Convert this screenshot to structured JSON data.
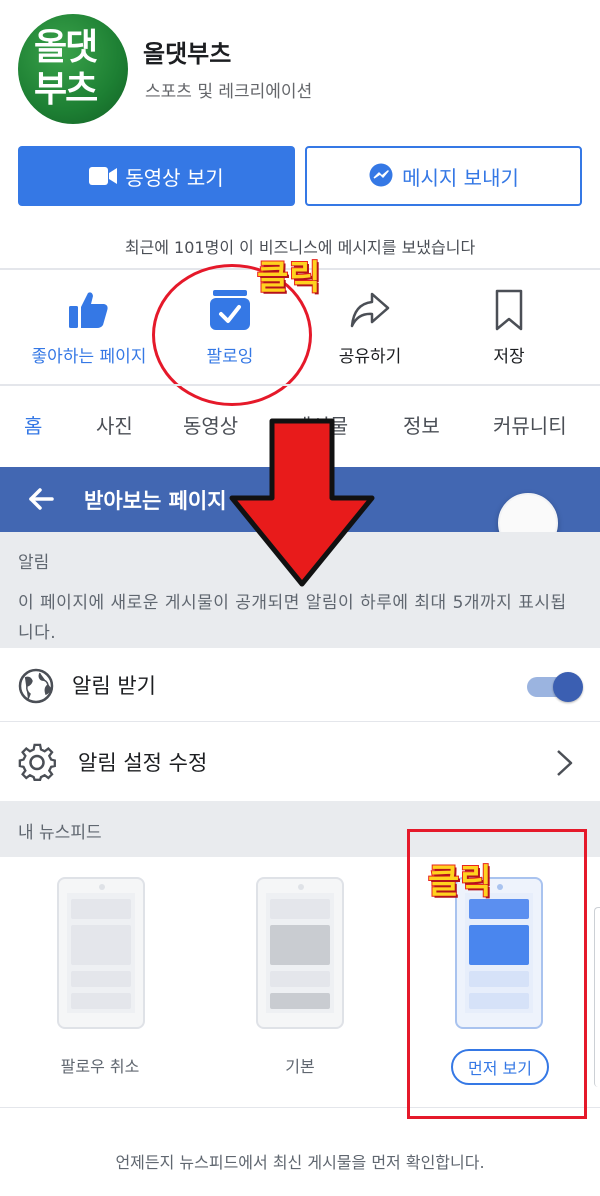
{
  "profile": {
    "logo_line1": "올댓",
    "logo_line2": "부츠",
    "name": "올댓부츠",
    "category": "스포츠 및 레크리에이션",
    "video_button": "동영상 보기",
    "message_button": "메시지 보내기",
    "message_stat": "최근에 101명이 이 비즈니스에 메시지를 보냈습니다"
  },
  "actions": [
    {
      "label": "좋아하는 페이지",
      "icon": "thumbs-up-icon"
    },
    {
      "label": "팔로잉",
      "icon": "following-icon"
    },
    {
      "label": "공유하기",
      "icon": "share-icon"
    },
    {
      "label": "저장",
      "icon": "bookmark-icon"
    }
  ],
  "annotations": {
    "click_1": "클릭",
    "click_2": "클릭"
  },
  "tabs": [
    "홈",
    "사진",
    "동영상",
    "게시물",
    "정보",
    "커뮤니티"
  ],
  "follow_screen": {
    "title": "받아보는 페이지",
    "notice_header": "알림",
    "notice_body": "이 페이지에 새로운 게시물이 공개되면 알림이 하루에 최대 5개까지 표시됩니다.",
    "notify_label": "알림 받기",
    "notify_on": true,
    "settings_label": "알림 설정 수정",
    "feed_header": "내 뉴스피드",
    "options": [
      "팔로우 취소",
      "기본",
      "먼저 보기"
    ],
    "footer": "언제든지 뉴스피드에서 최신 게시물을 먼저 확인합니다."
  },
  "colors": {
    "accent": "#3578e5",
    "titlebar": "#4267b2",
    "annotation_red": "#e5192a",
    "annotation_yellow": "#ffd21f"
  }
}
